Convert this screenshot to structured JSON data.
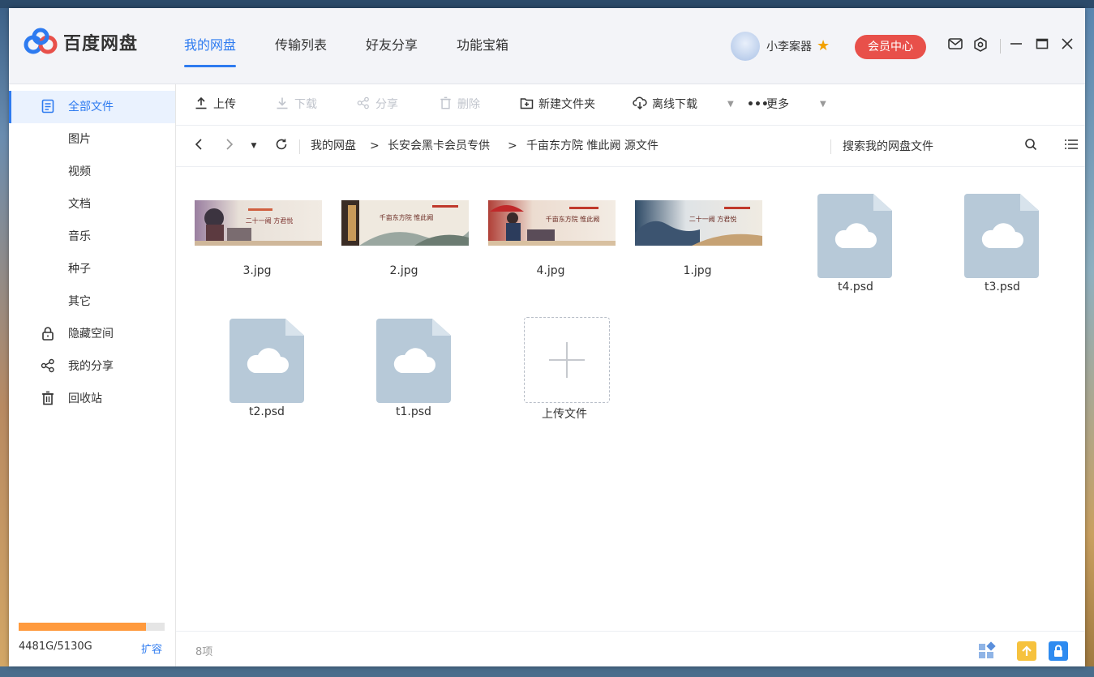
{
  "app": {
    "logo_text": "百度网盘",
    "brand_color": "#2e7bf0"
  },
  "nav": {
    "items": [
      {
        "label": "我的网盘",
        "active": true
      },
      {
        "label": "传输列表",
        "active": false
      },
      {
        "label": "好友分享",
        "active": false
      },
      {
        "label": "功能宝箱",
        "active": false
      }
    ]
  },
  "user": {
    "name": "小李案器",
    "vip_label": "会员中心",
    "vip_color": "#e8504a"
  },
  "sidebar": {
    "items": [
      {
        "label": "全部文件",
        "icon": "document-icon",
        "active": true
      },
      {
        "label": "图片",
        "icon": "",
        "active": false
      },
      {
        "label": "视频",
        "icon": "",
        "active": false
      },
      {
        "label": "文档",
        "icon": "",
        "active": false
      },
      {
        "label": "音乐",
        "icon": "",
        "active": false
      },
      {
        "label": "种子",
        "icon": "",
        "active": false
      },
      {
        "label": "其它",
        "icon": "",
        "active": false
      },
      {
        "label": "隐藏空间",
        "icon": "lock-icon",
        "active": false
      },
      {
        "label": "我的分享",
        "icon": "share-icon",
        "active": false
      },
      {
        "label": "回收站",
        "icon": "trash-icon",
        "active": false
      }
    ],
    "quota_text": "4481G/5130G",
    "quota_used_fraction": 0.8735,
    "expand_label": "扩容"
  },
  "toolbar": {
    "upload": "上传",
    "download": "下载",
    "share": "分享",
    "delete": "删除",
    "new_folder": "新建文件夹",
    "offline_download": "离线下载",
    "more": "更多"
  },
  "path": {
    "crumbs": [
      "我的网盘",
      "长安会黑卡会员专供",
      "千亩东方院 惟此阙 源文件"
    ],
    "separator": ">",
    "search_placeholder": "搜索我的网盘文件"
  },
  "files": [
    {
      "name": "3.jpg",
      "type": "image"
    },
    {
      "name": "2.jpg",
      "type": "image"
    },
    {
      "name": "4.jpg",
      "type": "image"
    },
    {
      "name": "1.jpg",
      "type": "image"
    },
    {
      "name": "t4.psd",
      "type": "psd"
    },
    {
      "name": "t3.psd",
      "type": "psd"
    },
    {
      "name": "t2.psd",
      "type": "psd"
    },
    {
      "name": "t1.psd",
      "type": "psd"
    }
  ],
  "upload_tile_label": "上传文件",
  "thumb_text": {
    "t3": "二十一阙 方君悦",
    "t2": "千亩东方院 惟此阙",
    "t4": "千亩东方院 惟此阙",
    "t1": "二十一阙 方君悦"
  },
  "status": {
    "item_count": "8项"
  }
}
